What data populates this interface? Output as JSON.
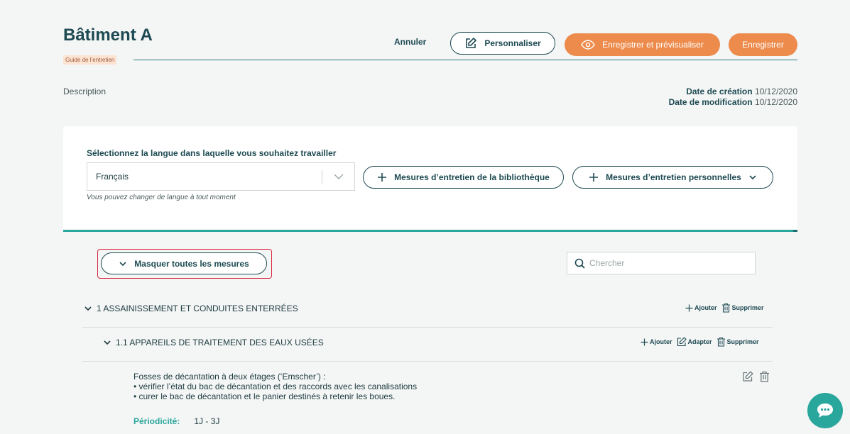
{
  "header": {
    "title": "Bâtiment A",
    "tag": "Guide de l’entretien",
    "cancel_label": "Annuler",
    "personalize_label": "Personnaliser",
    "save_preview_label": "Enregistrer et prévisualiser",
    "save_label": "Enregistrer",
    "description_label": "Description",
    "created_label": "Date de création",
    "created_value": "10/12/2020",
    "modified_label": "Date de modification",
    "modified_value": "10/12/2020"
  },
  "language": {
    "label": "Sélectionnez la langue dans laquelle vous souhaitez travailler",
    "selected": "Français",
    "hint": "Vous pouvez changer de langue à tout moment"
  },
  "toolbar": {
    "library_label": "Mesures d’entretien de la bibliothèque",
    "personal_label": "Mesures d’entretien personnelles",
    "collapse_label": "Masquer toutes les mesures",
    "search_placeholder": "Chercher"
  },
  "tree": {
    "section": {
      "label": "1 ASSAINISSEMENT ET CONDUITES ENTERRÉES",
      "add_label": "Ajouter",
      "delete_label": "Supprimer"
    },
    "subsection": {
      "label": "1.1 APPAREILS DE TRAITEMENT DES EAUX USÉES",
      "add_label": "Ajouter",
      "adapt_label": "Adapter",
      "delete_label": "Supprimer"
    },
    "item": {
      "line1": "Fosses de décantation à deux étages (‘Emscher’) :",
      "line2": "• vérifier l’état du bac de décantation et des raccords avec les canalisations",
      "line3": "• curer le bac de décantation et le panier destinés à retenir les boues.",
      "period_label": "Périodicité:",
      "period_value": "1J - 3J"
    }
  },
  "colors": {
    "accent_orange": "#ec8b4c",
    "accent_teal": "#2aa79c",
    "primary_dark": "#1d4a52",
    "highlight_red": "#d9263f"
  },
  "icons": {
    "personalize": "edit-icon",
    "preview": "eye-icon",
    "plus": "plus-icon",
    "chevron": "chevron-down-icon",
    "search": "search-icon",
    "delete": "trash-icon",
    "chat": "chat-icon"
  }
}
